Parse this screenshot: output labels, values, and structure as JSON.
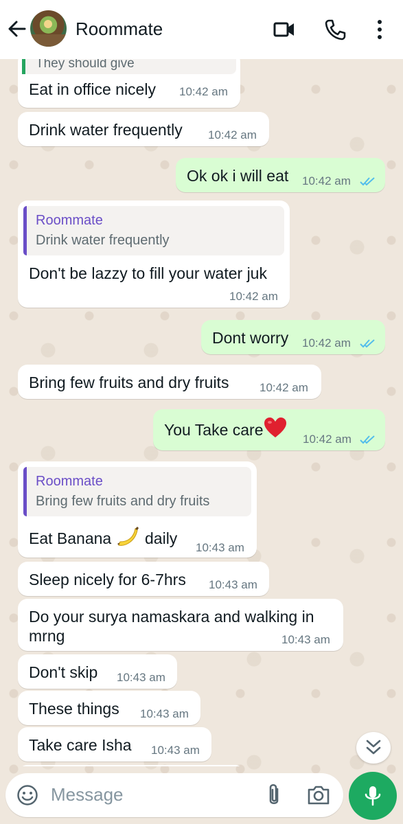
{
  "header": {
    "contact_name": "Roommate"
  },
  "partial_quote": "They should give",
  "messages": [
    {
      "dir": "in",
      "text": "Eat in office nicely",
      "time": "10:42 am"
    },
    {
      "dir": "in",
      "text": "Drink water frequently",
      "time": "10:42 am"
    },
    {
      "dir": "out",
      "text": "Ok ok i will eat",
      "time": "10:42 am",
      "status": "read"
    },
    {
      "dir": "in",
      "quote_author": "Roommate",
      "quote_text": "Drink water frequently",
      "text": "Don't be lazzy to fill your water juk",
      "time": "10:42 am"
    },
    {
      "dir": "out",
      "text": "Dont worry",
      "time": "10:42 am",
      "status": "read"
    },
    {
      "dir": "in",
      "text": "Bring few fruits and dry fruits",
      "time": "10:42 am"
    },
    {
      "dir": "out",
      "text": "You Take care",
      "emoji": "red-heart",
      "time": "10:42 am",
      "status": "read"
    },
    {
      "dir": "in",
      "quote_author": "Roommate",
      "quote_text": "Bring few fruits and dry fruits",
      "text_before": "Eat Banana",
      "emoji": "banana",
      "text_after": "daily",
      "time": "10:43 am"
    },
    {
      "dir": "in",
      "text": "Sleep nicely for 6-7hrs",
      "time": "10:43 am"
    },
    {
      "dir": "in",
      "text_line1": "Do your surya namaskara and walking in",
      "text_line2": "mrng",
      "time": "10:43 am"
    },
    {
      "dir": "in",
      "text": "Don't skip",
      "time": "10:43 am"
    },
    {
      "dir": "in",
      "text": "These things",
      "time": "10:43 am"
    },
    {
      "dir": "in",
      "text": "Take care Isha",
      "time": "10:43 am"
    }
  ],
  "composer": {
    "placeholder": "Message"
  },
  "icons": {
    "back": "arrow-left-icon",
    "video": "video-camera-icon",
    "call": "phone-icon",
    "menu": "more-vertical-icon",
    "emoji": "emoji-smiley-icon",
    "attach": "paperclip-icon",
    "camera": "camera-icon",
    "mic": "microphone-icon",
    "scroll": "double-chevron-down-icon"
  },
  "colors": {
    "incoming_bubble": "#ffffff",
    "outgoing_bubble": "#d9fdd3",
    "read_ticks": "#53bdeb",
    "quote_accent": "#6a4ec7",
    "mic_button": "#1daa61"
  }
}
